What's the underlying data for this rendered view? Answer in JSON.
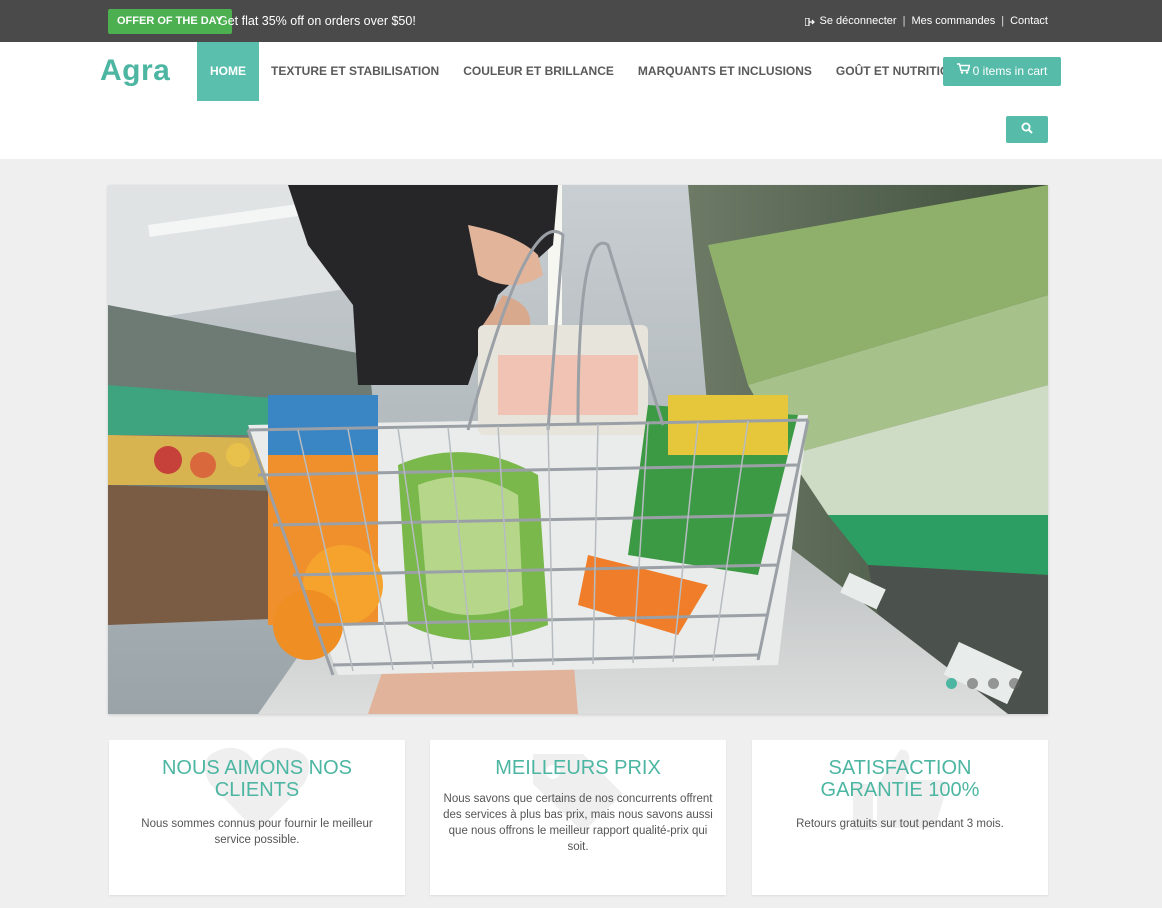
{
  "topbar": {
    "offer_badge": "OFFER OF THE DAY",
    "offer_text": "Get flat 35% off on orders over $50!",
    "links": {
      "logout": "Se déconnecter",
      "orders": "Mes commandes",
      "contact": "Contact",
      "separator": "|"
    },
    "logout_icon": "sign-out-icon"
  },
  "header": {
    "logo": "Agra",
    "nav": [
      "HOME",
      "TEXTURE ET STABILISATION",
      "COULEUR ET BRILLANCE",
      "MARQUANTS ET INCLUSIONS",
      "GOÛT ET NUTRITION"
    ],
    "active_nav": "HOME",
    "cart_label": "0 items in cart",
    "cart_icon": "shopping-cart-icon",
    "search_icon": "search-icon"
  },
  "hero": {
    "image": "shopper holding a wire basket full of groceries in a supermarket aisle",
    "slides": 4,
    "active_slide": 1
  },
  "features": [
    {
      "title": "NOUS AIMONS NOS CLIENTS",
      "text": "Nous sommes connus pour fournir le meilleur service possible.",
      "icon": "heart-icon"
    },
    {
      "title": "MEILLEURS PRIX",
      "text": "Nous savons que certains de nos concurrents offrent des services à plus bas prix, mais nous savons aussi que nous offrons le meilleur rapport qualité-prix qui soit.",
      "icon": "tag-icon"
    },
    {
      "title": "SATISFACTION GARANTIE 100%",
      "text": "Retours gratuits sur tout pendant 3 mois.",
      "icon": "thumbs-up-icon"
    }
  ],
  "colors": {
    "accent": "#56bba9",
    "logo": "#4db6a2",
    "topbar": "#4a4a4a",
    "offer_badge": "#4caf50"
  }
}
